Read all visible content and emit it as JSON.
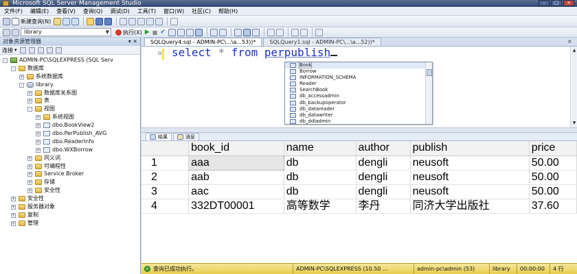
{
  "window": {
    "title": "Microsoft SQL Server Management Studio"
  },
  "menu": [
    "文件(F)",
    "编辑(E)",
    "查看(V)",
    "查询(Q)",
    "调试(D)",
    "工具(T)",
    "窗口(W)",
    "社区(C)",
    "帮助(H)"
  ],
  "toolbar": {
    "new_query": "新建查询(N)",
    "database": "library",
    "execute": "执行(X)"
  },
  "object_explorer": {
    "title": "对象资源管理器",
    "connect": "连接",
    "tree": [
      {
        "label": "ADMIN-PC\\SQLEXPRESS (SQL Serv",
        "level": 0,
        "exp": "-",
        "icon": "server"
      },
      {
        "label": "数据库",
        "level": 1,
        "exp": "-",
        "icon": "folder"
      },
      {
        "label": "系统数据库",
        "level": 2,
        "exp": "+",
        "icon": "folder"
      },
      {
        "label": "library",
        "level": 2,
        "exp": "-",
        "icon": "db"
      },
      {
        "label": "数据库关系图",
        "level": 3,
        "exp": "+",
        "icon": "folder"
      },
      {
        "label": "表",
        "level": 3,
        "exp": "+",
        "icon": "folder"
      },
      {
        "label": "视图",
        "level": 3,
        "exp": "-",
        "icon": "folder"
      },
      {
        "label": "系统视图",
        "level": 4,
        "exp": "+",
        "icon": "folder"
      },
      {
        "label": "dbo.BookView2",
        "level": 4,
        "exp": "+",
        "icon": "view"
      },
      {
        "label": "dbo.PerPublish_AVG",
        "level": 4,
        "exp": "+",
        "icon": "view"
      },
      {
        "label": "dbo.ReaderInfo",
        "level": 4,
        "exp": "+",
        "icon": "view"
      },
      {
        "label": "dbo.WXBorrow",
        "level": 4,
        "exp": "+",
        "icon": "view"
      },
      {
        "label": "同义词",
        "level": 3,
        "exp": "+",
        "icon": "folder"
      },
      {
        "label": "可编程性",
        "level": 3,
        "exp": "+",
        "icon": "folder"
      },
      {
        "label": "Service Broker",
        "level": 3,
        "exp": "+",
        "icon": "folder"
      },
      {
        "label": "存储",
        "level": 3,
        "exp": "+",
        "icon": "folder"
      },
      {
        "label": "安全性",
        "level": 3,
        "exp": "+",
        "icon": "folder"
      },
      {
        "label": "安全性",
        "level": 1,
        "exp": "+",
        "icon": "folder"
      },
      {
        "label": "服务器对象",
        "level": 1,
        "exp": "+",
        "icon": "folder"
      },
      {
        "label": "复制",
        "level": 1,
        "exp": "+",
        "icon": "folder"
      },
      {
        "label": "管理",
        "level": 1,
        "exp": "+",
        "icon": "folder"
      }
    ]
  },
  "tabs": [
    {
      "label": "SQLQuery4.sql - ADMIN-PC\\...\\a...53))*",
      "active": true
    },
    {
      "label": "SQLQuery1.sql - ADMIN-PC\\...\\a...52))*",
      "active": false
    }
  ],
  "editor": {
    "kw_select": "select",
    "op_star": "*",
    "kw_from": "from",
    "ident": "perpublish"
  },
  "autocomplete": {
    "items": [
      "Book",
      "Borrow",
      "INFORMATION_SCHEMA",
      "Reader",
      "SearchBook",
      "db_accessadmin",
      "db_backupoperator",
      "db_datareader",
      "db_datawriter",
      "db_ddladmin"
    ],
    "selected": 0
  },
  "results_tabs": [
    "结果",
    "消息"
  ],
  "results": {
    "columns": [
      "",
      "book_id",
      "name",
      "author",
      "publish",
      "price"
    ],
    "rows": [
      [
        "1",
        "aaa",
        "db",
        "dengli",
        "neusoft",
        "50.00"
      ],
      [
        "2",
        "aab",
        "db",
        "dengli",
        "neusoft",
        "50.00"
      ],
      [
        "3",
        "aac",
        "db",
        "dengli",
        "neusoft",
        "50.00"
      ],
      [
        "4",
        "332DT00001",
        "高等数学",
        "李丹",
        "同济大学出版社",
        "37.60"
      ]
    ]
  },
  "status": {
    "message": "查询已成功执行。",
    "server": "ADMIN-PC\\SQLEXPRESS (10.50 ...",
    "user": "admin-pc\\admin (53)",
    "database": "library",
    "time": "00:00:00",
    "rows": "4 行"
  },
  "colors": {
    "status_bg": "#f1df78",
    "keyword": "#1c2fc9",
    "title_bar": "#3b5282"
  }
}
